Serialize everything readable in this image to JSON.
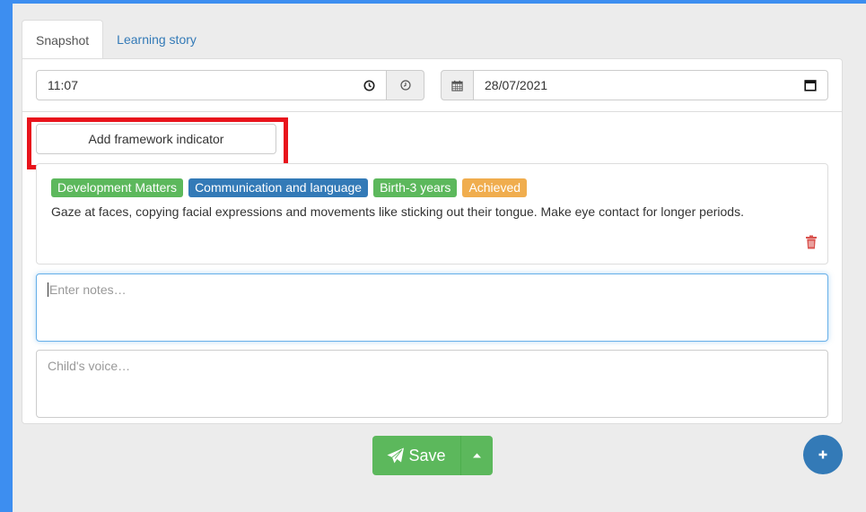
{
  "tabs": [
    {
      "label": "Snapshot",
      "active": true
    },
    {
      "label": "Learning story",
      "active": false
    }
  ],
  "time": {
    "value": "11:07",
    "icon": "clock-icon"
  },
  "date": {
    "value": "28/07/2021",
    "icon": "calendar-icon"
  },
  "add_framework_label": "Add framework indicator",
  "framework": {
    "labels": [
      {
        "text": "Development Matters",
        "color": "#5cb85c"
      },
      {
        "text": "Communication and language",
        "color": "#337ab7"
      },
      {
        "text": "Birth-3 years",
        "color": "#5cb85c"
      },
      {
        "text": "Achieved",
        "color": "#f0ad4e"
      }
    ],
    "description": "Gaze at faces, copying facial expressions and movements like sticking out their tongue. Make eye contact for longer periods."
  },
  "notes": {
    "placeholder": "Enter notes…"
  },
  "voice": {
    "placeholder": "Child's voice…"
  },
  "save_label": "Save",
  "colors": {
    "accent": "#3d8ef0",
    "success": "#5cb85c",
    "primary": "#337ab7",
    "danger": "#d9534f",
    "highlight": "#e8131c"
  }
}
